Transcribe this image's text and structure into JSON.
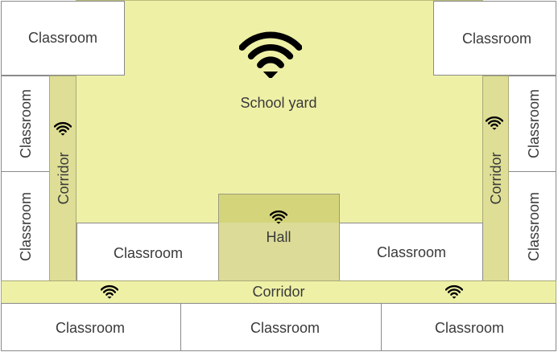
{
  "labels": {
    "classroom": "Classroom",
    "school_yard": "School yard",
    "hall": "Hall",
    "corridor": "Corridor"
  },
  "icons": {
    "wifi": "wifi-icon"
  },
  "colors": {
    "yard": "#eef0a6",
    "corridor": "#dede96",
    "hall": "#dcdc98",
    "border": "#8a8a8a"
  }
}
